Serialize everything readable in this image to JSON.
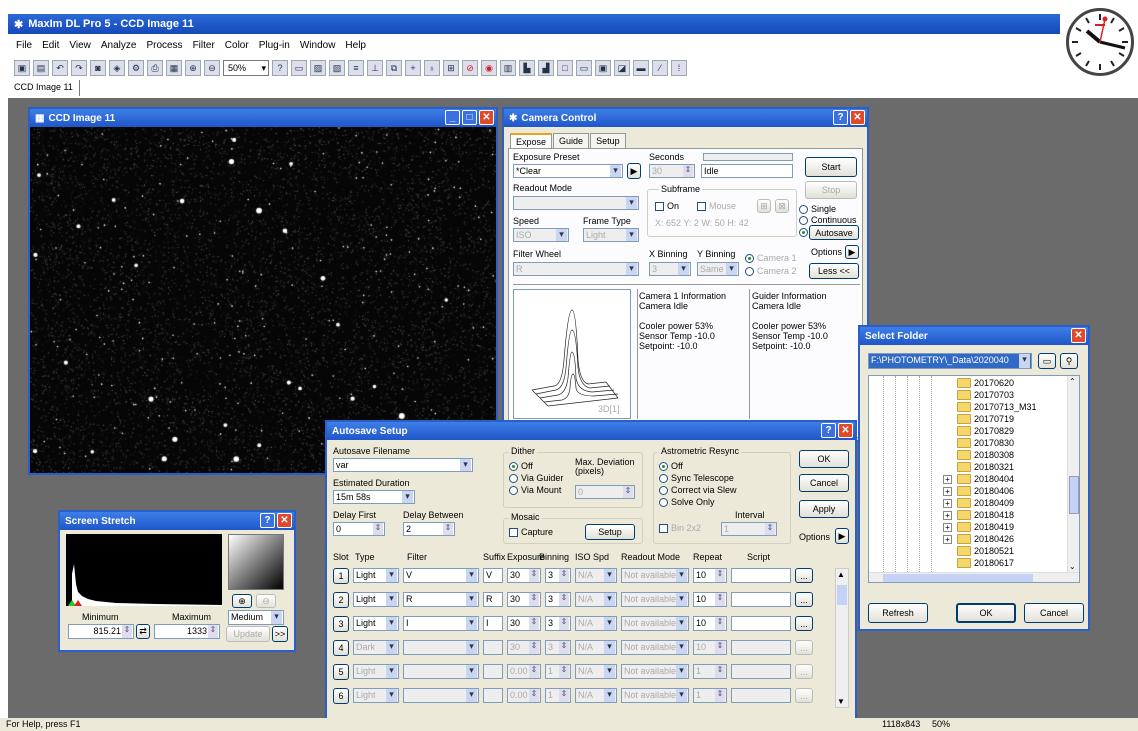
{
  "app": {
    "title": "MaxIm DL Pro 5 - CCD Image 11",
    "menu": [
      "File",
      "Edit",
      "View",
      "Analyze",
      "Process",
      "Filter",
      "Color",
      "Plug-in",
      "Window",
      "Help"
    ],
    "zoom": "50%",
    "doc_tab": "CCD Image 11",
    "status_help": "For Help, press F1",
    "status_size": "1118x843",
    "status_zoom": "50%"
  },
  "image_window": {
    "title": "CCD Image 11"
  },
  "camera": {
    "title": "Camera Control",
    "tabs": [
      "Expose",
      "Guide",
      "Setup"
    ],
    "exposure_preset_label": "Exposure Preset",
    "exposure_preset": "*Clear",
    "seconds_label": "Seconds",
    "seconds": "30",
    "state": "Idle",
    "readout_label": "Readout Mode",
    "readout": "",
    "subframe_label": "Subframe",
    "on_label": "On",
    "mouse_label": "Mouse",
    "subframe_coords": "X: 652 Y:  2 W: 50 H: 42",
    "speed_label": "Speed",
    "speed": "ISO",
    "frame_type_label": "Frame Type",
    "frame_type": "Light",
    "filter_wheel_label": "Filter Wheel",
    "filter": "R",
    "xbin_label": "X Binning",
    "ybin_label": "Y Binning",
    "xbin": "3",
    "ybin": "Same",
    "camera1_label": "Camera 1",
    "camera2_label": "Camera 2",
    "start": "Start",
    "stop": "Stop",
    "single": "Single",
    "continuous": "Continuous",
    "autosave": "Autosave",
    "options": "Options",
    "less": "Less <<",
    "cam1_info": [
      "Camera 1 Information",
      "Camera Idle",
      "",
      "Cooler power 53%",
      "Sensor Temp -10.0",
      "Setpoint: -10.0"
    ],
    "guider_info": [
      "Guider Information",
      "Camera Idle",
      "",
      "Cooler power 53%",
      "Sensor Temp -10.0",
      "Setpoint: -10.0"
    ],
    "plot_label": "3D[1]"
  },
  "folder": {
    "title": "Select Folder",
    "path": "F:\\PHOTOMETRY\\_Data\\2020040",
    "items": [
      "20170620",
      "20170703",
      "20170713_M31",
      "20170719",
      "20170829",
      "20170830",
      "20180308",
      "20180321",
      "20180404",
      "20180406",
      "20180409",
      "20180418",
      "20180419",
      "20180426",
      "20180521",
      "20180617"
    ],
    "expanders": [
      "+",
      "+",
      "+",
      "+",
      "+",
      "+"
    ],
    "refresh": "Refresh",
    "ok": "OK",
    "cancel": "Cancel"
  },
  "stretch": {
    "title": "Screen Stretch",
    "min_label": "Minimum",
    "max_label": "Maximum",
    "min": "815.21",
    "max": "1333",
    "mode": "Medium",
    "update": "Update",
    "more": ">>"
  },
  "autosave": {
    "title": "Autosave Setup",
    "filename_label": "Autosave Filename",
    "filename": "var",
    "duration_label": "Estimated Duration",
    "duration": "15m 58s",
    "delay_first_label": "Delay First",
    "delay_first": "0",
    "delay_between_label": "Delay Between",
    "delay_between": "2",
    "dither_label": "Dither",
    "dither_off": "Off",
    "via_guider": "Via Guider",
    "via_mount": "Via Mount",
    "max_dev_label": "Max. Deviation (pixels)",
    "max_dev": "0",
    "mosaic_label": "Mosaic",
    "capture": "Capture",
    "setup": "Setup",
    "astro_label": "Astrometric Resync",
    "astro_off": "Off",
    "sync_tel": "Sync Telescope",
    "correct_slew": "Correct via Slew",
    "solve_only": "Solve Only",
    "interval_label": "Interval",
    "bin2x2": "Bin 2x2",
    "interval": "1",
    "ok": "OK",
    "cancel": "Cancel",
    "apply": "Apply",
    "options": "Options",
    "cols": [
      "Slot",
      "Type",
      "Filter",
      "Suffix",
      "Exposure",
      "Binning",
      "ISO Spd",
      "Readout Mode",
      "Repeat",
      "Script"
    ],
    "rows": [
      {
        "slot": "1",
        "type": "Light",
        "filter": "V",
        "suffix": "V",
        "exp": "30",
        "bin": "3",
        "iso": "N/A",
        "readout": "Not available",
        "repeat": "10",
        "script": "...",
        "enabled": true
      },
      {
        "slot": "2",
        "type": "Light",
        "filter": "R",
        "suffix": "R",
        "exp": "30",
        "bin": "3",
        "iso": "N/A",
        "readout": "Not available",
        "repeat": "10",
        "script": "...",
        "enabled": true
      },
      {
        "slot": "3",
        "type": "Light",
        "filter": "I",
        "suffix": "I",
        "exp": "30",
        "bin": "3",
        "iso": "N/A",
        "readout": "Not available",
        "repeat": "10",
        "script": "...",
        "enabled": true
      },
      {
        "slot": "4",
        "type": "Dark",
        "filter": "",
        "suffix": "",
        "exp": "30",
        "bin": "3",
        "iso": "N/A",
        "readout": "Not available",
        "repeat": "10",
        "script": "...",
        "enabled": false
      },
      {
        "slot": "5",
        "type": "Light",
        "filter": "",
        "suffix": "",
        "exp": "0.00",
        "bin": "1",
        "iso": "N/A",
        "readout": "Not available",
        "repeat": "1",
        "script": "...",
        "enabled": false
      },
      {
        "slot": "6",
        "type": "Light",
        "filter": "",
        "suffix": "",
        "exp": "0.00",
        "bin": "1",
        "iso": "N/A",
        "readout": "Not available",
        "repeat": "1",
        "script": "...",
        "enabled": false
      }
    ]
  }
}
